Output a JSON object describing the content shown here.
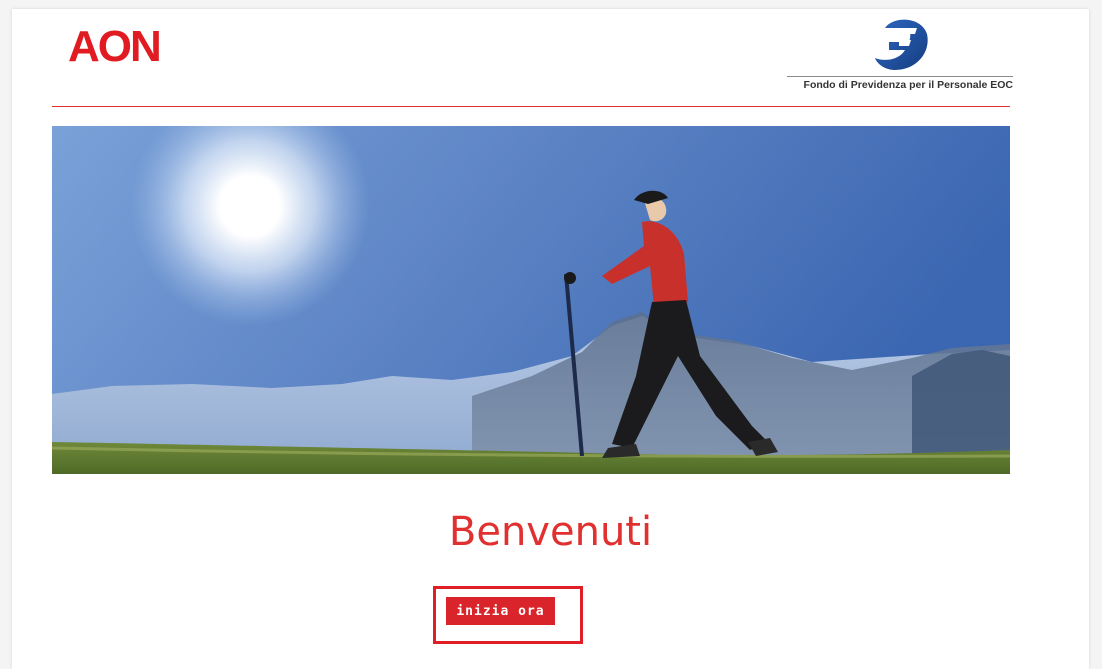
{
  "header": {
    "brand_logo_text": "AON",
    "fund_name": "Fondo di Previdenza per il Personale EOC"
  },
  "main": {
    "welcome_title": "Benvenuti",
    "cta_label": "inizia ora"
  },
  "colors": {
    "brand_red": "#e11b22",
    "button_red": "#d8242a",
    "fund_blue": "#1f4f9c",
    "divider_red": "#e0302f"
  },
  "icons": {
    "fund_logo": "fund-f-logo-icon"
  }
}
